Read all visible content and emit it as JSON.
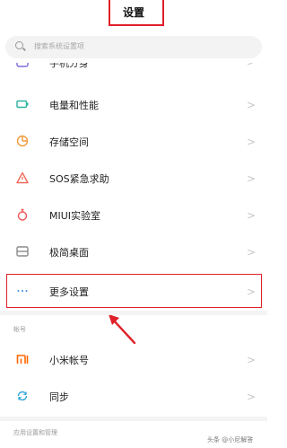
{
  "header": {
    "title": "设置"
  },
  "search": {
    "placeholder": "搜索系统设置项"
  },
  "partial_item": {
    "label": "手机分身"
  },
  "items": [
    {
      "label": "电量和性能",
      "icon": "battery-icon",
      "color": "#2ab4a0"
    },
    {
      "label": "存储空间",
      "icon": "storage-pie-icon",
      "color": "#f39b3d"
    },
    {
      "label": "SOS紧急求助",
      "icon": "sos-warning-icon",
      "color": "#ef6a5b"
    },
    {
      "label": "MIUI实验室",
      "icon": "flask-icon",
      "color": "#f45757"
    },
    {
      "label": "极简桌面",
      "icon": "simple-desktop-icon",
      "color": "#8c8c8c"
    },
    {
      "label": "更多设置",
      "icon": "more-dots-icon",
      "color": "#3b8de0"
    }
  ],
  "section_account": {
    "title": "帐号"
  },
  "account_items": [
    {
      "label": "小米帐号",
      "icon": "mi-logo-icon",
      "color": "#ff6700"
    },
    {
      "label": "同步",
      "icon": "sync-icon",
      "color": "#2aa3d7"
    }
  ],
  "section_apps": {
    "title": "应用设置和管理"
  },
  "chevron": ">",
  "watermark": {
    "text": "头条 @小尼解答"
  },
  "accent_red": "#e0202a"
}
